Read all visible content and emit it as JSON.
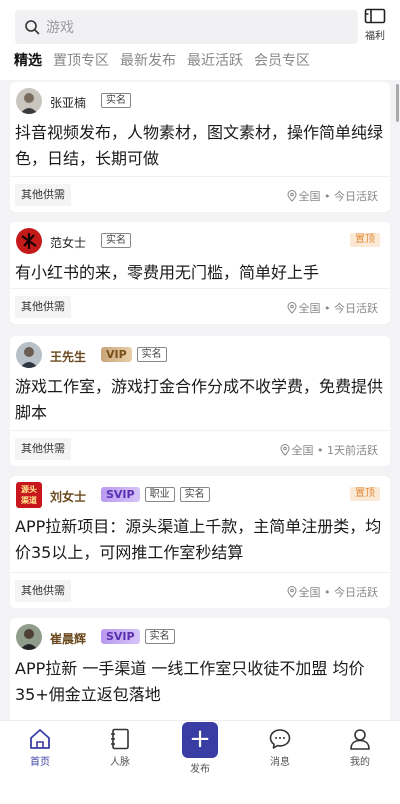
{
  "search": {
    "placeholder": "游戏"
  },
  "welfare": {
    "label": "福利"
  },
  "tabs": [
    {
      "label": "精选",
      "active": true
    },
    {
      "label": "置顶专区"
    },
    {
      "label": "最新发布"
    },
    {
      "label": "最近活跃"
    },
    {
      "label": "会员专区"
    }
  ],
  "posts": [
    {
      "author": "张亚楠",
      "badges": [
        "实名"
      ],
      "pinned": false,
      "content": "抖音视频发布，人物素材，图文素材，操作简单纯绿色，日结，长期可做",
      "tag": "其他供需",
      "location": "全国",
      "activity": "今日活跃"
    },
    {
      "author": "范女士",
      "badges": [
        "实名"
      ],
      "pinned": true,
      "pin_label": "置顶",
      "content": "有小红书的来，零费用无门槛，简单好上手",
      "tag": "其他供需",
      "location": "全国",
      "activity": "今日活跃"
    },
    {
      "author": "王先生",
      "level": "VIP",
      "badges": [
        "实名"
      ],
      "pinned": false,
      "content": "游戏工作室，游戏打金合作分成不收学费，免费提供脚本",
      "tag": "其他供需",
      "location": "全国",
      "activity": "1天前活跃"
    },
    {
      "author": "刘女士",
      "level": "SVIP",
      "badges": [
        "职业",
        "实名"
      ],
      "pinned": true,
      "pin_label": "置顶",
      "content": "APP拉新项目：源头渠道上千款，主简单注册类，均价35以上，可网推工作室秒结算",
      "tag": "其他供需",
      "location": "全国",
      "activity": "今日活跃"
    },
    {
      "author": "崔晨辉",
      "level": "SVIP",
      "badges": [
        "实名"
      ],
      "pinned": false,
      "content": "APP拉新 一手渠道 一线工作室只收徒不加盟 均价35+佣金立返包落地"
    }
  ],
  "avatar_text": {
    "post3": "源头\n渠道"
  },
  "nav": [
    {
      "label": "首页",
      "icon": "home-icon",
      "active": true
    },
    {
      "label": "人脉",
      "icon": "contacts-icon"
    },
    {
      "label": "发布",
      "icon": "plus-icon"
    },
    {
      "label": "消息",
      "icon": "message-icon"
    },
    {
      "label": "我的",
      "icon": "profile-icon"
    }
  ],
  "colors": {
    "accent": "#3a3ea4",
    "pin": "#e08a3c",
    "svip": "#5a2fb0",
    "vip": "#c9a57a"
  }
}
